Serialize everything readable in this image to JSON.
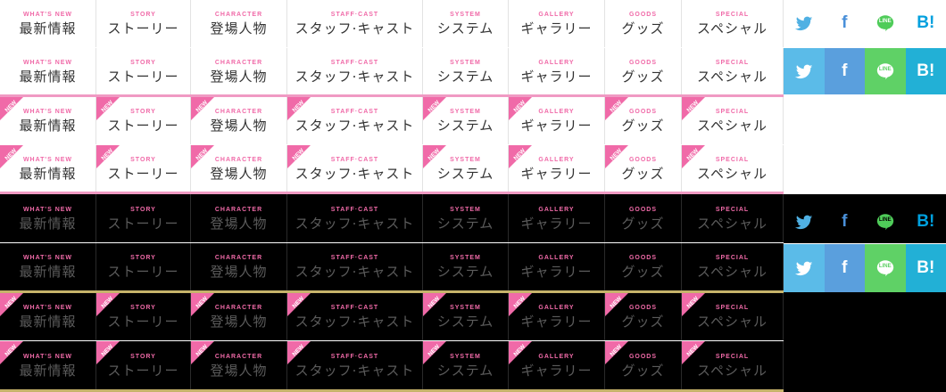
{
  "nav": [
    {
      "en": "WHAT'S NEW",
      "ja": "最新情報"
    },
    {
      "en": "STORY",
      "ja": "ストーリー"
    },
    {
      "en": "CHARACTER",
      "ja": "登場人物"
    },
    {
      "en": "STAFF·CAST",
      "ja": "スタッフ·キャスト"
    },
    {
      "en": "SYSTEM",
      "ja": "システム"
    },
    {
      "en": "GALLERY",
      "ja": "ギャラリー"
    },
    {
      "en": "GOODS",
      "ja": "グッズ"
    },
    {
      "en": "SPECIAL",
      "ja": "スペシャル"
    }
  ],
  "new_badge": "NEW",
  "social": [
    {
      "icon": "twitter-icon",
      "label": "",
      "color": "#4fb0e3"
    },
    {
      "icon": "facebook-icon",
      "label": "f",
      "color": "#4a90d9"
    },
    {
      "icon": "line-icon",
      "label": "LINE",
      "color": "#4fcc59"
    },
    {
      "icon": "hatena-bookmark-icon",
      "label": "B!",
      "color": "#00a0de"
    }
  ],
  "colors": {
    "accent_pink": "#f06aa8",
    "rule_gold": "#c6b36a",
    "light_bg": "#ffffff",
    "dark_bg": "#000000",
    "social_text_light": "#ffffff"
  }
}
